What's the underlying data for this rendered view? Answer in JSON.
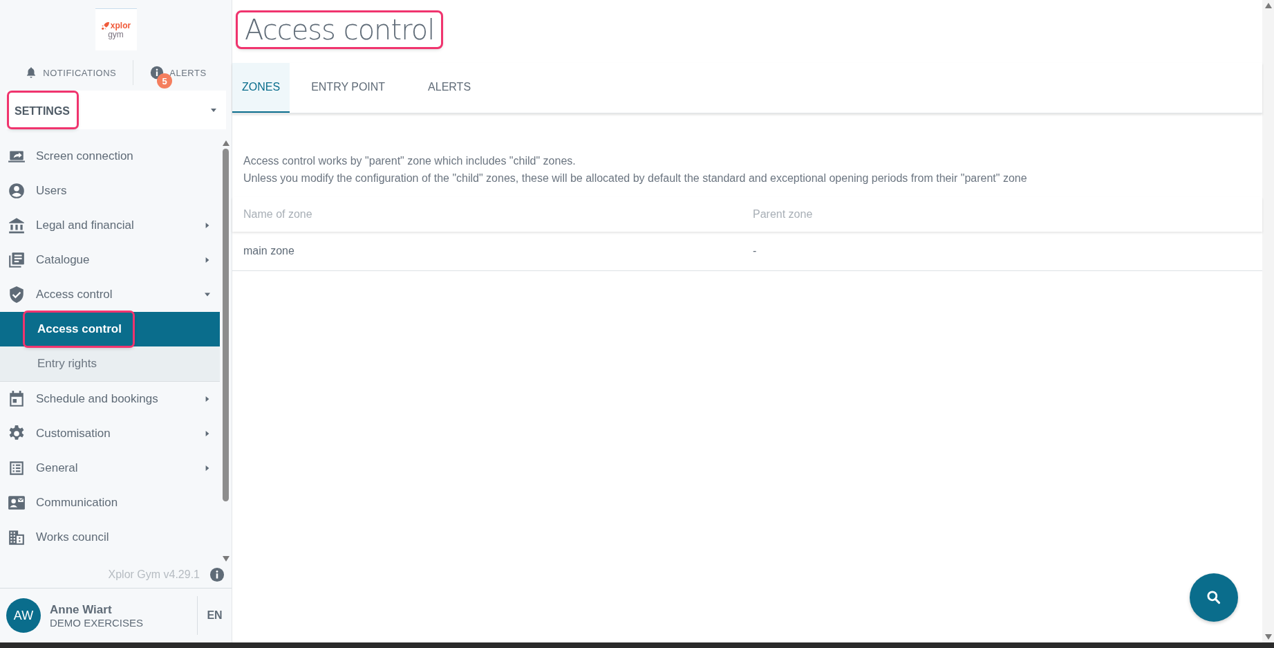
{
  "logo": {
    "brand": "xplor",
    "product": "gym"
  },
  "top_links": [
    {
      "kind": "notifications",
      "label": "NOTIFICATIONS"
    },
    {
      "kind": "alerts",
      "label": "ALERTS",
      "badge": "5"
    }
  ],
  "section_select": {
    "value": "SETTINGS",
    "highlighted": true
  },
  "menu": [
    {
      "label": "Screen connection",
      "kind": "screen",
      "has_submenu": false
    },
    {
      "label": "Users",
      "kind": "user",
      "has_submenu": false
    },
    {
      "label": "Legal and financial",
      "kind": "bank",
      "has_submenu": true,
      "expanded": false
    },
    {
      "label": "Catalogue",
      "kind": "catalogue",
      "has_submenu": true,
      "expanded": false
    },
    {
      "label": "Access control",
      "kind": "shield",
      "has_submenu": true,
      "expanded": true,
      "children": [
        {
          "label": "Access control",
          "selected": true,
          "highlighted": true
        },
        {
          "label": "Entry rights",
          "selected": false,
          "highlighted": false
        }
      ]
    },
    {
      "label": "Schedule and bookings",
      "kind": "calendar",
      "has_submenu": true,
      "expanded": false
    },
    {
      "label": "Customisation",
      "kind": "gear",
      "has_submenu": true,
      "expanded": false
    },
    {
      "label": "General",
      "kind": "list",
      "has_submenu": true,
      "expanded": false
    },
    {
      "label": "Communication",
      "kind": "contact",
      "has_submenu": false
    },
    {
      "label": "Works council",
      "kind": "building",
      "has_submenu": false
    }
  ],
  "version": "Xplor Gym v4.29.1",
  "user": {
    "initials": "AW",
    "name": "Anne Wiart",
    "organisation": "DEMO EXERCISES",
    "language": "EN"
  },
  "page": {
    "title": "Access control",
    "title_highlighted": true
  },
  "tabs": [
    {
      "label": "ZONES",
      "selected": true
    },
    {
      "label": "ENTRY POINT",
      "selected": false
    },
    {
      "label": "ALERTS",
      "selected": false
    }
  ],
  "description": [
    "Access control works by \"parent\" zone which includes \"child\" zones.",
    "Unless you modify the configuration of the \"child\" zones, these will be allocated by default the standard and exceptional opening periods from their \"parent\" zone"
  ],
  "table": {
    "columns": [
      "Name of zone",
      "Parent zone"
    ],
    "rows": [
      [
        "main zone",
        "-"
      ]
    ]
  }
}
